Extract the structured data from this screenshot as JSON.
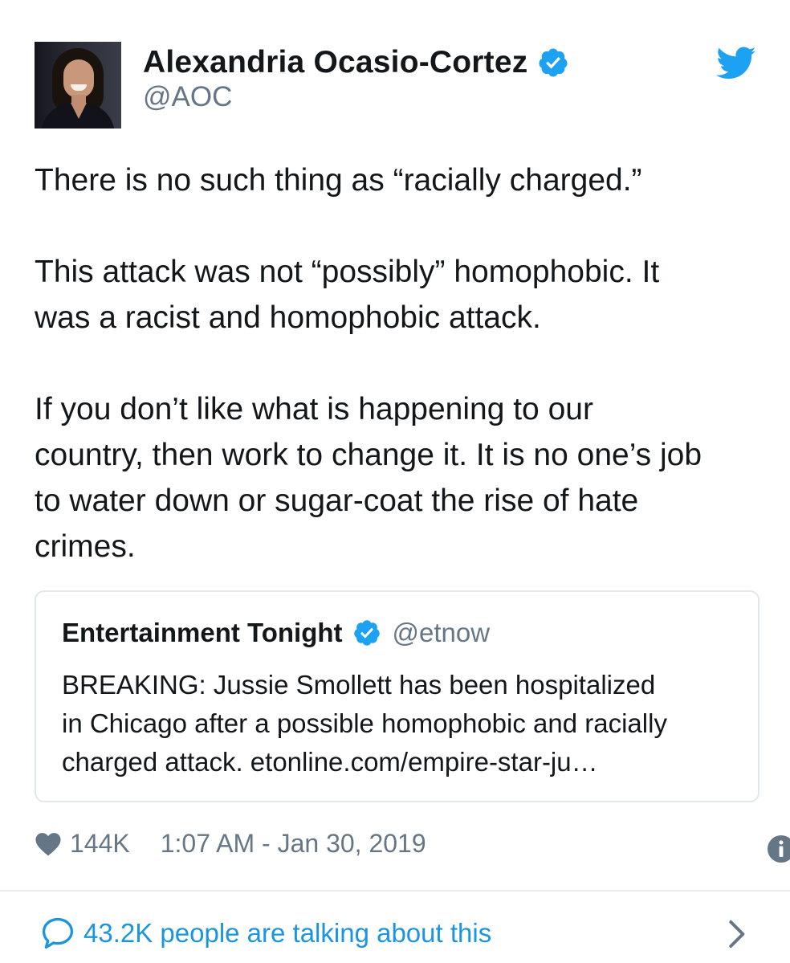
{
  "tweet": {
    "author": {
      "display_name": "Alexandria Ocasio-Cortez",
      "handle": "@AOC"
    },
    "paragraphs": [
      [
        "There is no such thing as “racially charged.”"
      ],
      [
        "This attack was not “possibly” homophobic. It",
        "was a racist and homophobic attack."
      ],
      [
        "If you don’t like what is happening to our",
        "country, then work to change it. It is no one’s job",
        "to water down or sugar-coat the rise of hate",
        "crimes."
      ]
    ],
    "quote": {
      "display_name": "Entertainment Tonight",
      "handle": "@etnow",
      "lines": [
        "BREAKING: Jussie Smollett has been hospitalized",
        "in Chicago after a possible homophobic and racially",
        "charged attack. etonline.com/empire-star-ju…"
      ]
    },
    "likes": "144K",
    "timestamp": "1:07 AM - Jan 30, 2019",
    "talking_label": "43.2K people are talking about this"
  },
  "icons": {
    "verified": "verified-badge-icon",
    "brand": "twitter-bird-icon",
    "like": "heart-icon",
    "info": "info-icon",
    "conversation": "speech-bubble-icon",
    "navigate": "chevron-right-icon"
  },
  "colors": {
    "accent": "#1da1f2",
    "link": "#1b95e0",
    "text": "#14171a",
    "secondary": "#657786",
    "border": "#e1e8ed"
  }
}
